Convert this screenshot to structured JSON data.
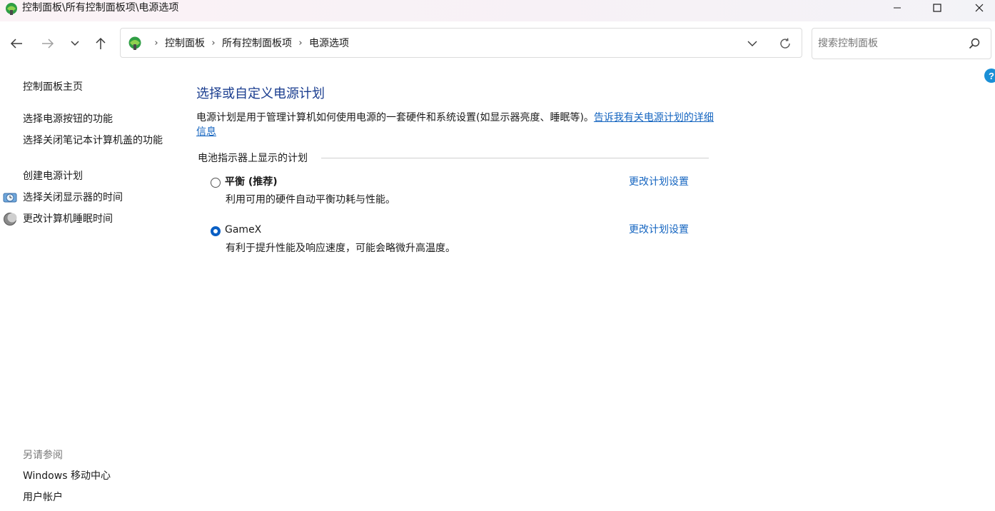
{
  "window": {
    "title": "控制面板\\所有控制面板项\\电源选项",
    "minimize_icon": "minimize-icon",
    "maximize_icon": "maximize-icon",
    "close_icon": "close-icon",
    "app_icon": "control-panel-icon"
  },
  "address": {
    "crumbs": [
      "控制面板",
      "所有控制面板项",
      "电源选项"
    ],
    "crumb_separator": "›"
  },
  "search": {
    "placeholder": "搜索控制面板"
  },
  "help": {
    "label": "?"
  },
  "sidebar": {
    "home": "控制面板主页",
    "items": [
      "选择电源按钮的功能",
      "选择关闭笔记本计算机盖的功能",
      "创建电源计划",
      "选择关闭显示器的时间",
      "更改计算机睡眠时间"
    ],
    "see_also_title": "另请参阅",
    "see_also": [
      "Windows 移动中心",
      "用户帐户"
    ]
  },
  "main": {
    "title": "选择或自定义电源计划",
    "description": "电源计划是用于管理计算机如何使用电源的一套硬件和系统设置(如显示器亮度、睡眠等)。",
    "description_link": "告诉我有关电源计划的详细信息",
    "section_header": "电池指示器上显示的计划",
    "plans": [
      {
        "name_main": "平衡",
        "name_suffix": " (推荐)",
        "description": "利用可用的硬件自动平衡功耗与性能。",
        "selected": false,
        "link": "更改计划设置"
      },
      {
        "name_main": "GameX",
        "name_suffix": "",
        "description": "有利于提升性能及响应速度，可能会略微升高温度。",
        "selected": true,
        "link": "更改计划设置"
      }
    ]
  },
  "colors": {
    "title_blue": "#1a3d8f",
    "link_blue": "#1565c0",
    "radio_selected": "#0a5fc4"
  }
}
